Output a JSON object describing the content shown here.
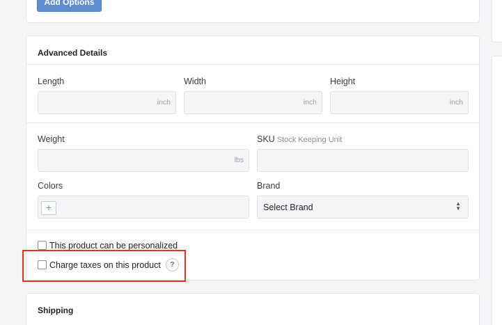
{
  "top": {
    "add_options_label": "Add Options"
  },
  "advanced": {
    "title": "Advanced Details",
    "length": {
      "label": "Length",
      "value": "",
      "unit": "inch"
    },
    "width": {
      "label": "Width",
      "value": "",
      "unit": "inch"
    },
    "height": {
      "label": "Height",
      "value": "",
      "unit": "inch"
    },
    "weight": {
      "label": "Weight",
      "value": "",
      "unit": "lbs"
    },
    "sku": {
      "label": "SKU",
      "sublabel": "Stock Keeping Unit",
      "value": ""
    },
    "colors": {
      "label": "Colors",
      "add_icon": "plus-icon"
    },
    "brand": {
      "label": "Brand",
      "selected": "Select Brand"
    },
    "personalized": {
      "label": "This product can be personalized",
      "checked": false
    },
    "taxes": {
      "label": "Charge taxes on this product",
      "checked": false,
      "help": "?"
    }
  },
  "shipping": {
    "title": "Shipping"
  },
  "colors": {
    "highlight": "#e8321e",
    "primary": "#5e8ecf"
  }
}
